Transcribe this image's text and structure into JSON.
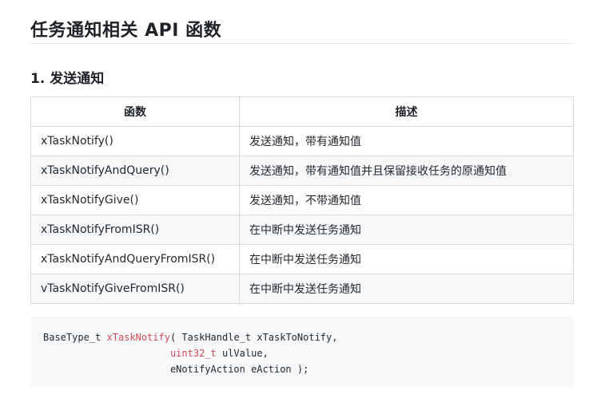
{
  "heading": "任务通知相关 API 函数",
  "section": "1. 发送通知",
  "table": {
    "headers": [
      "函数",
      "描述"
    ],
    "rows": [
      {
        "func": "xTaskNotify()",
        "desc": "发送通知，带有通知值"
      },
      {
        "func": "xTaskNotifyAndQuery()",
        "desc": "发送通知，带有通知值并且保留接收任务的原通知值"
      },
      {
        "func": "xTaskNotifyGive()",
        "desc": "发送通知，不带通知值"
      },
      {
        "func": "xTaskNotifyFromISR()",
        "desc": "在中断中发送任务通知"
      },
      {
        "func": "xTaskNotifyAndQueryFromISR()",
        "desc": "在中断中发送任务通知"
      },
      {
        "func": "vTaskNotifyGiveFromISR()",
        "desc": "在中断中发送任务通知"
      }
    ]
  },
  "code": {
    "return_type": "BaseType_t",
    "fn_name": "xTaskNotify",
    "line1_rest": "( TaskHandle_t xTaskToNotify,",
    "line2_indent": "                      ",
    "line2_type": "uint32_t",
    "line2_rest": " ulValue,",
    "line3": "                      eNotifyAction eAction );",
    "colors": {
      "highlight": "#d14b5a",
      "background": "#f6f8fa"
    }
  }
}
